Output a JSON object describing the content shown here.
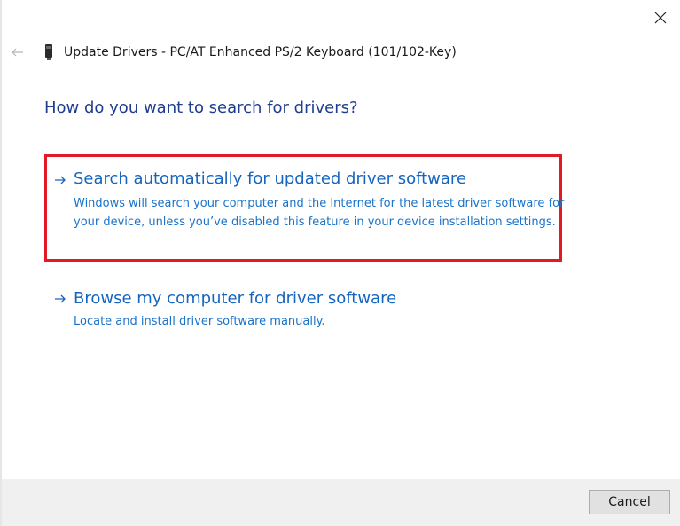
{
  "window": {
    "title": "Update Drivers - PC/AT Enhanced PS/2 Keyboard (101/102-Key)",
    "close_icon": "close-icon",
    "back_icon": "back-arrow-icon",
    "device_icon": "keyboard-device-icon"
  },
  "main": {
    "heading": "How do you want to search for drivers?",
    "options": [
      {
        "title": "Search automatically for updated driver software",
        "description": "Windows will search your computer and the Internet for the latest driver software for your device, unless you’ve disabled this feature in your device installation settings.",
        "icon": "arrow-right-icon",
        "highlighted": true
      },
      {
        "title": "Browse my computer for driver software",
        "description": "Locate and install driver software manually.",
        "icon": "arrow-right-icon",
        "highlighted": false
      }
    ]
  },
  "footer": {
    "cancel_label": "Cancel"
  },
  "colors": {
    "heading": "#1f3d8e",
    "link": "#1565c0",
    "highlight_border": "#e11a24",
    "footer_bg": "#f0f0f0"
  }
}
